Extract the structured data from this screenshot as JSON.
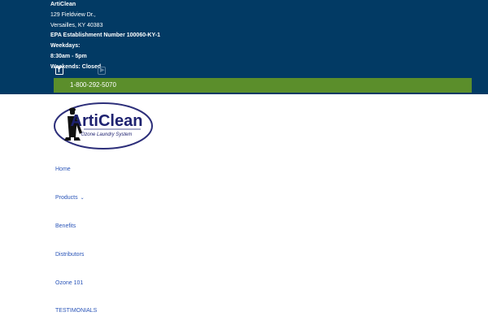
{
  "topbar": {
    "company": "ArtiClean",
    "address1": "129 Fieldview Dr.,",
    "address2": "Versailles, KY 40383",
    "epa": "EPA Establishment Number 100060-KY-1",
    "weekdays_label": "Weekdays:",
    "weekdays_hours": "8:30am - 5pm",
    "weekends": "Weekends: Closed",
    "facebook_icon": "facebook-icon",
    "youtube_icon": "youtube-icon",
    "phone": "1-800-292-5070",
    "colors": {
      "background": "#023a64",
      "phone_bar": "#5b8e2b"
    }
  },
  "logo": {
    "brand": "ArtiClean",
    "tagline": "Ozone Laundry System",
    "colors": {
      "oval": "#2d2f7a",
      "text": "#1e2270"
    }
  },
  "nav": {
    "items": [
      {
        "label": "Home"
      },
      {
        "label": "Products"
      },
      {
        "label": "Benefits"
      },
      {
        "label": "Distributors"
      },
      {
        "label": "Ozone 101"
      },
      {
        "label": "TESTIMONIALS"
      }
    ],
    "link_color": "#2a55b8"
  }
}
